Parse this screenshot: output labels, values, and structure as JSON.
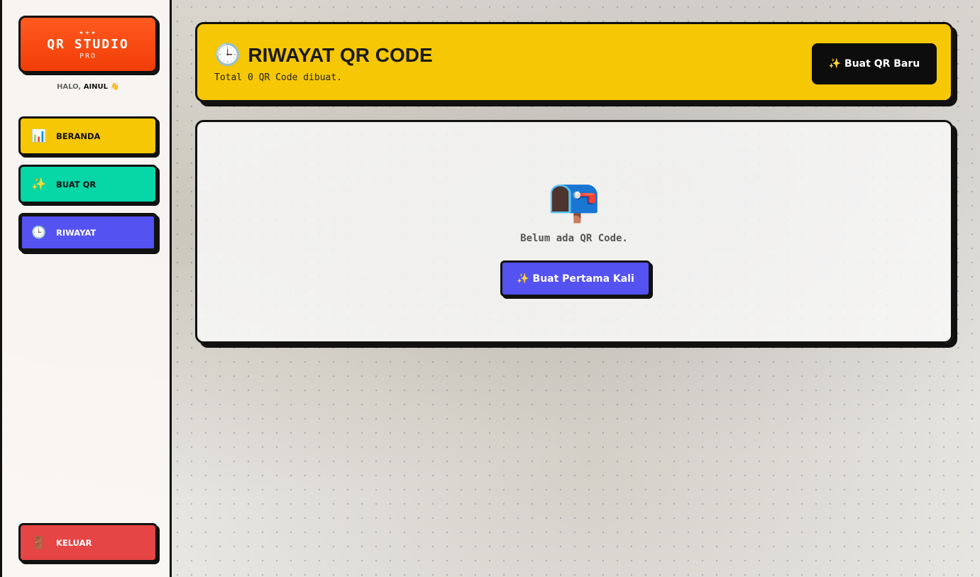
{
  "app": {
    "stars": "✦✦✦",
    "title": "QR STUDIO",
    "subtitle": "PRO",
    "greeting_prefix": "HALO,",
    "user_name": "AINUL",
    "wave": "👋"
  },
  "sidebar": {
    "items": [
      {
        "label": "BERANDA",
        "icon": "📊",
        "icon_name": "chart-icon"
      },
      {
        "label": "BUAT QR",
        "icon": "✨",
        "icon_name": "sparkles-icon"
      },
      {
        "label": "RIWAYAT",
        "icon": "🕒",
        "icon_name": "clock-icon",
        "active": true
      }
    ],
    "logout": {
      "label": "KELUAR",
      "icon": "🚪",
      "icon_name": "door-icon"
    }
  },
  "header": {
    "icon": "🕒",
    "title": "RIWAYAT QR CODE",
    "subtitle": "Total 0 QR Code dibuat.",
    "new_button": "✨ Buat QR Baru"
  },
  "empty_state": {
    "icon": "📭",
    "message": "Belum ada QR Code.",
    "button": "✨ Buat Pertama Kali"
  },
  "colors": {
    "logo": "#f23d07",
    "yellow": "#f6c704",
    "teal": "#07d6a7",
    "indigo": "#5552f2",
    "red": "#e54545",
    "black": "#111111"
  }
}
